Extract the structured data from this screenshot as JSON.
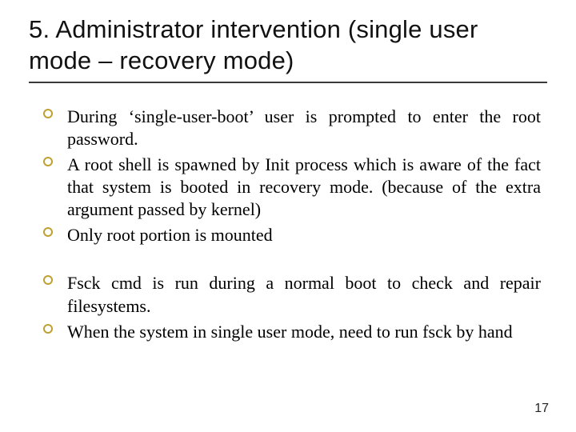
{
  "title": "5. Administrator intervention (single user mode – recovery mode)",
  "group1": {
    "b1": "During ‘single-user-boot’ user is prompted to enter the root password.",
    "b2": "A root shell is spawned by Init process which is aware of the fact that system is booted in recovery mode. (because of the extra argument passed by kernel)",
    "b3": "Only root portion is mounted"
  },
  "group2": {
    "b1": "Fsck cmd is run during a normal boot to check and repair filesystems.",
    "b2": "When the system in single user mode, need to run fsck by hand"
  },
  "page_number": "17"
}
